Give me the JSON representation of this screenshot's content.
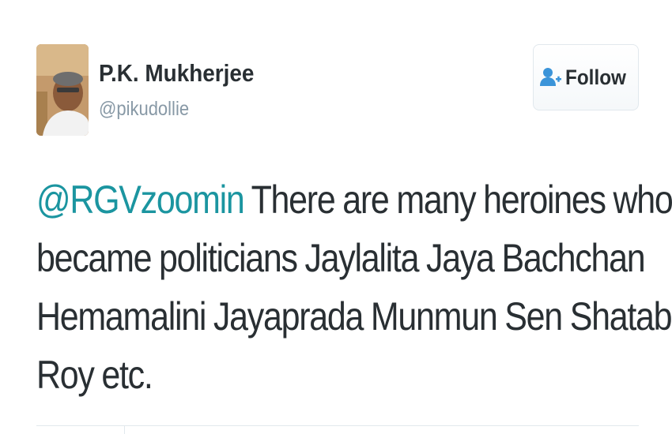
{
  "user": {
    "display_name": "P.K. Mukherjee",
    "handle": "@pikudollie",
    "avatar_icon": "profile-photo"
  },
  "follow_button": {
    "label": "Follow",
    "icon": "add-user-icon"
  },
  "tweet": {
    "mention": "@RGVzoomin",
    "line1_rest": " There are many heroines who",
    "line2": "became politicians Jaylalita Jaya Bachchan",
    "line3": "Hemamalini Jayaprada Munmun Sen Shatabdi",
    "line4": "Roy etc."
  },
  "colors": {
    "mention": "#1b95a0",
    "text": "#292f33",
    "handle": "#8899a6",
    "icon": "#3b94d9"
  }
}
